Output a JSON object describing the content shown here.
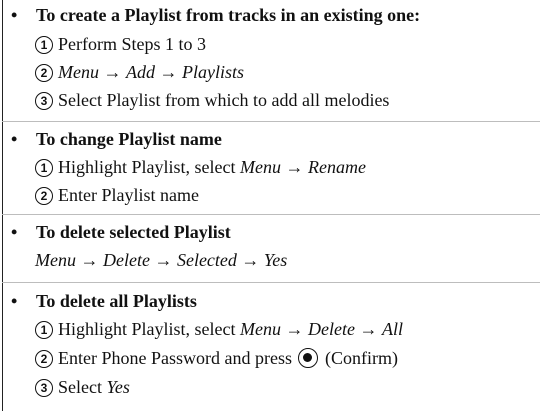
{
  "bullet": "•",
  "arrow": "→",
  "sections": [
    {
      "heading": "To create a Playlist from tracks in an existing one:",
      "steps": [
        {
          "num": "1",
          "text": "Perform Steps 1 to 3"
        },
        {
          "num": "2",
          "a": "Menu",
          "b": "Add",
          "c": "Playlists"
        },
        {
          "num": "3",
          "text": "Select Playlist from which to add all melodies"
        }
      ]
    },
    {
      "heading": "To change Playlist name",
      "steps": [
        {
          "num": "1",
          "pre": "Highlight Playlist, select ",
          "a": "Menu",
          "b": "Rename"
        },
        {
          "num": "2",
          "text": "Enter Playlist name"
        }
      ]
    },
    {
      "heading": "To delete selected Playlist",
      "steps": [
        {
          "a": "Menu",
          "b": "Delete",
          "c": "Selected",
          "d": "Yes"
        }
      ]
    },
    {
      "heading": "To delete all Playlists",
      "steps": [
        {
          "num": "1",
          "pre": "Highlight Playlist, select ",
          "a": "Menu",
          "b": "Delete",
          "c": "All"
        },
        {
          "num": "2",
          "pre": "Enter Phone Password and press ",
          "icon": "confirm-button-icon",
          "post": " (Confirm)"
        },
        {
          "num": "3",
          "pre": "Select ",
          "a": "Yes"
        }
      ]
    }
  ]
}
